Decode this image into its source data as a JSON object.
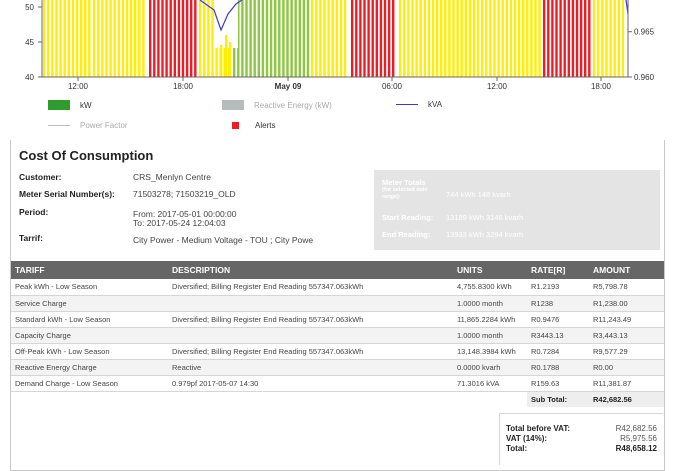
{
  "chart_data": {
    "type": "bar",
    "y_left_ticks": [
      "40",
      "45",
      "50"
    ],
    "y_right_ticks": [
      "0.960",
      "0.965"
    ],
    "x_ticks": [
      "12:00",
      "18:00",
      "May 09",
      "06:00",
      "12:00",
      "18:00"
    ],
    "ylim_left": [
      40,
      51
    ],
    "ylim_right": [
      0.96,
      0.9685
    ],
    "bar_colors_by_tariff": {
      "off_peak": "#8dc63f",
      "standard": "#ffee00",
      "peak": "#ee1c25"
    },
    "bar_sequence": [
      "standard",
      "peak",
      "standard",
      "standard",
      "off_peak",
      "standard",
      "peak",
      "standard",
      "standard",
      "peak"
    ],
    "kva_series_visible": "dip near 20:00",
    "series": [
      {
        "name": "kW"
      },
      {
        "name": "Reactive Energy (kW)"
      },
      {
        "name": "kVA"
      },
      {
        "name": "Power Factor"
      },
      {
        "name": "Alerts"
      }
    ],
    "colors": {
      "kw": "#2e9c2e",
      "reactive": "#b6bcbc",
      "kva": "#3a3ad6",
      "power_factor": "#bdbdbd",
      "alerts": "#ee1c25",
      "green": "#8dc63f",
      "yellow": "#ffee00",
      "red": "#ee1c25"
    }
  },
  "legend": {
    "kw": "kW",
    "reactive": "Reactive Energy (kW)",
    "kva": "kVA",
    "power_factor": "Power Factor",
    "alerts": "Alerts"
  },
  "cost": {
    "title": "Cost Of Consumption",
    "customer_label": "Customer:",
    "customer_value": "CRS_Menlyn Centre",
    "meter_label": "Meter Serial Number(s):",
    "meter_value": "71503278; 71503219_OLD",
    "period_label": "Period:",
    "period_from": "From:  2017-05-01 00:00:00",
    "period_to": "To:     2017-05-24 12:04:03",
    "tarrif_label": "Tarrif:",
    "tarrif_value": "City Power - Medium Voltage - TOU ; City Powe"
  },
  "meter_totals": {
    "label": "Meter Totals",
    "sub": "(for selected date range):",
    "totals_value": "744 kWh 148 kvarh",
    "start_label": "Start Reading:",
    "start_value": "13189 kWh 3146 kvarh",
    "end_label": "End Reading:",
    "end_value": "13933 kWh 3294 kvarh"
  },
  "table": {
    "headers": {
      "tariff": "TARIFF",
      "description": "DESCRIPTION",
      "units": "UNITS",
      "rate": "RATE[R]",
      "amount": "AMOUNT"
    },
    "rows": [
      {
        "tariff": "Peak kWh - Low Season",
        "description": "Diversified; Billing Register End Reading 557347.063kWh",
        "units": "4,755.8300 kWh",
        "rate": "R1.2193",
        "amount": "R5,798.78"
      },
      {
        "tariff": "Service Charge",
        "description": "",
        "units": "1.0000 month",
        "rate": "R1238",
        "amount": "R1,238.00"
      },
      {
        "tariff": "Standard kWh - Low Season",
        "description": "Diversified; Billing Register End Reading 557347.063kWh",
        "units": "11,865.2284 kWh",
        "rate": "R0.9476",
        "amount": "R11,243.49"
      },
      {
        "tariff": "Capacity Charge",
        "description": "",
        "units": "1.0000 month",
        "rate": "R3443.13",
        "amount": "R3,443.13"
      },
      {
        "tariff": "Off-Peak kWh - Low Season",
        "description": "Diversified; Billing Register End Reading 557347.063kWh",
        "units": "13,148.3984 kWh",
        "rate": "R0.7284",
        "amount": "R9,577.29"
      },
      {
        "tariff": "Reactive Energy Charge",
        "description": "Reactive",
        "units": "0.0000 kvarh",
        "rate": "R0.1788",
        "amount": "R0.00"
      },
      {
        "tariff": "Demand Charge - Low Season",
        "description": "0.979pf 2017-05-07 14:30",
        "units": "71.3016 kVA",
        "rate": "R159.63",
        "amount": "R11,381.87"
      }
    ],
    "subtotal_label": "Sub Total:",
    "subtotal_value": "R42,682.56"
  },
  "summary": {
    "before_vat_label": "Total before VAT:",
    "before_vat_value": "R42,682.56",
    "vat_label": "VAT (14%):",
    "vat_value": "R5,975.56",
    "total_label": "Total:",
    "total_value": "R48,658.12"
  }
}
